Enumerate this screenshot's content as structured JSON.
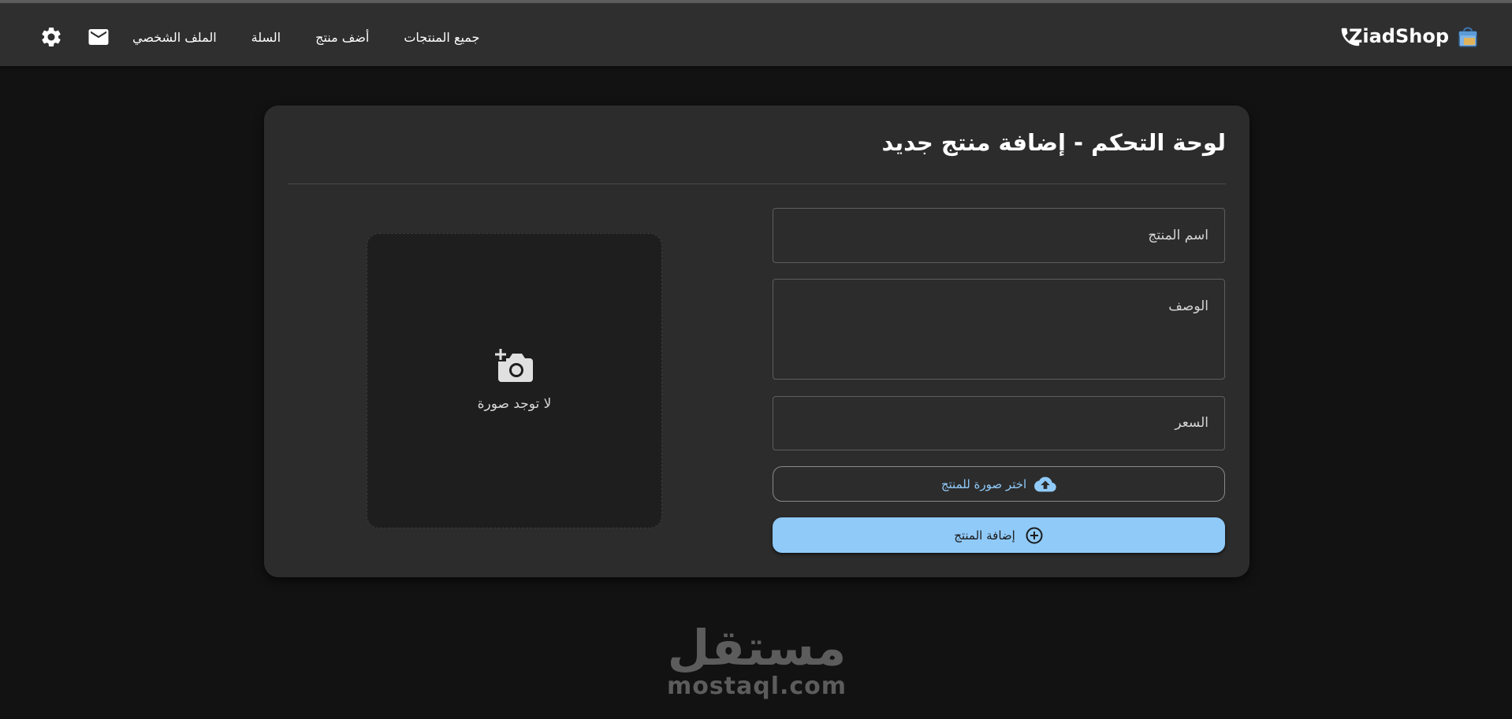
{
  "navbar": {
    "brand": "ZiadShop",
    "links": [
      {
        "label": "جميع المنتجات"
      },
      {
        "label": "أضف منتج"
      },
      {
        "label": "السلة"
      },
      {
        "label": "الملف الشخصي"
      }
    ],
    "icons": [
      "shopping-bag-icon",
      "phone-icon",
      "mail-icon",
      "gear-icon"
    ]
  },
  "card": {
    "title": "لوحة التحكم - إضافة منتج جديد",
    "fields": {
      "name_placeholder": "اسم المنتج",
      "description_placeholder": "الوصف",
      "price_placeholder": "السعر"
    },
    "choose_image_label": "اختر صورة للمنتج",
    "submit_label": "إضافة المنتج",
    "preview": {
      "empty_label": "لا توجد صورة"
    }
  },
  "watermark": {
    "arabic": "مستقل",
    "latin": "mostaql.com"
  },
  "colors": {
    "background": "#121212",
    "navbar": "#2f2f2f",
    "card": "#2c2c2c",
    "accent": "#90caf9"
  }
}
